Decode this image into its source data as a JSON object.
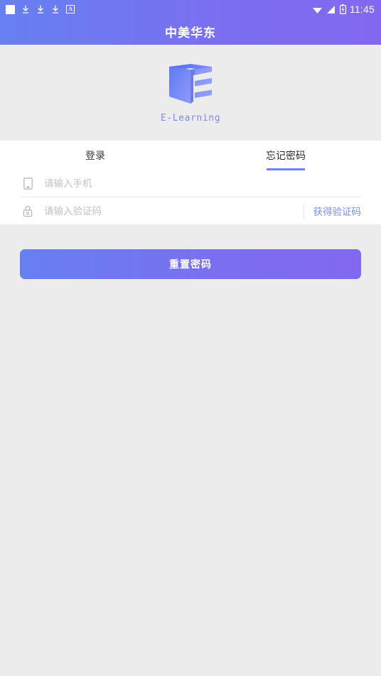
{
  "statusbar": {
    "icons_left": [
      "square-icon",
      "download-icon",
      "download-icon",
      "download-icon",
      "letter-a-icon"
    ],
    "letter_a": "A",
    "icons_right": [
      "wifi-icon",
      "signal-icon",
      "battery-charging-icon"
    ],
    "time": "11:45"
  },
  "header": {
    "title": "中美华东",
    "gradient_start": "#6680f0",
    "gradient_end": "#8268f0"
  },
  "logo": {
    "mark": "e-learning-book-icon",
    "caption": "E-Learning",
    "caption_color": "#7c8ce8"
  },
  "tabs": [
    {
      "label": "登录",
      "active": false
    },
    {
      "label": "忘记密码",
      "active": true
    }
  ],
  "tab_accent": "#6b82ef",
  "form": {
    "phone": {
      "icon": "mobile-phone-icon",
      "placeholder": "请输入手机",
      "value": ""
    },
    "code": {
      "icon": "lock-icon",
      "placeholder": "请输入验证码",
      "value": "",
      "button_label": "获得验证码",
      "button_color": "#7b8cf0"
    }
  },
  "submit": {
    "label": "重置密码"
  }
}
